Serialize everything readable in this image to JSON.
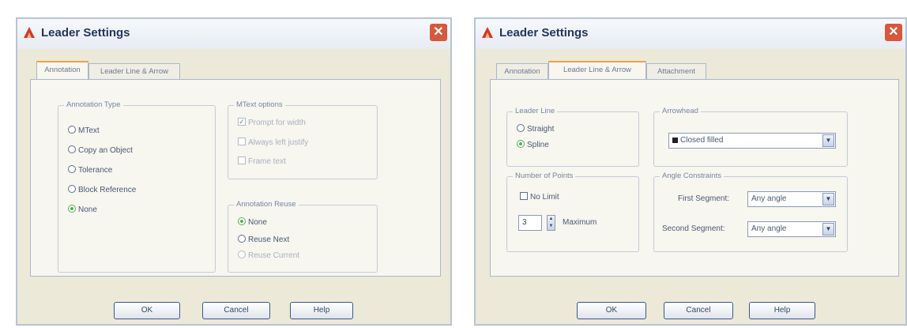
{
  "dialog_left": {
    "title": "Leader Settings",
    "close_glyph": "✕",
    "tabs": [
      "Annotation",
      "Leader Line & Arrow"
    ],
    "annotation_type": {
      "label": "Annotation Type",
      "options": [
        "MText",
        "Copy an Object",
        "Tolerance",
        "Block Reference",
        "None"
      ],
      "selected": "None"
    },
    "mtext_options": {
      "label": "MText options",
      "items": [
        "Prompt for width",
        "Always left justify",
        "Frame text"
      ]
    },
    "annotation_reuse": {
      "label": "Annotation Reuse",
      "options": [
        "None",
        "Reuse Next",
        "Reuse Current"
      ],
      "selected": "None"
    },
    "buttons": {
      "ok": "OK",
      "cancel": "Cancel",
      "help": "Help"
    }
  },
  "dialog_right": {
    "title": "Leader Settings",
    "close_glyph": "✕",
    "tabs": [
      "Annotation",
      "Leader Line & Arrow",
      "Attachment"
    ],
    "leader_line": {
      "label": "Leader Line",
      "options": [
        "Straight",
        "Spline"
      ],
      "selected": "Spline"
    },
    "arrowhead": {
      "label": "Arrowhead",
      "value": "Closed filled"
    },
    "number_of_points": {
      "label": "Number of Points",
      "no_limit": "No Limit",
      "value": "3",
      "maximum": "Maximum"
    },
    "angle_constraints": {
      "label": "Angle Constraints",
      "first_label": "First Segment:",
      "first_value": "Any angle",
      "second_label": "Second Segment:",
      "second_value": "Any angle"
    },
    "buttons": {
      "ok": "OK",
      "cancel": "Cancel",
      "help": "Help"
    }
  },
  "colors": {
    "accent_tab": "#f0a14a",
    "radio_selected": "#4fb34f",
    "close_button": "#d9573b"
  }
}
